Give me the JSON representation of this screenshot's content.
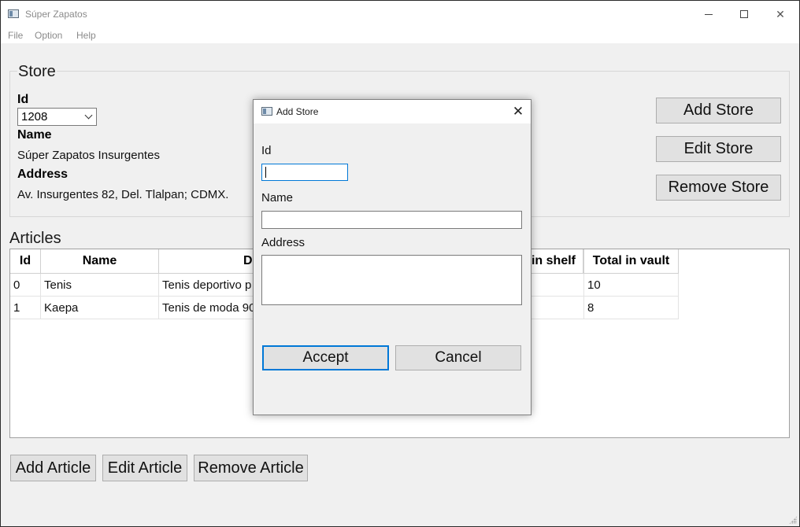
{
  "window": {
    "title": "Súper Zapatos",
    "controls": {
      "minimize": "minimize-icon",
      "maximize": "maximize-icon",
      "close": "✕"
    }
  },
  "menu": [
    "File",
    "Option",
    "Help"
  ],
  "store": {
    "group_title": "Store",
    "id_label": "Id",
    "id_value": "1208",
    "name_label": "Name",
    "name_value": "Súper Zapatos Insurgentes",
    "address_label": "Address",
    "address_value": "Av. Insurgentes 82, Del. Tlalpan; CDMX.",
    "buttons": {
      "add": "Add Store",
      "edit": "Edit Store",
      "remove": "Remove Store"
    }
  },
  "articles": {
    "title": "Articles",
    "columns": [
      "Id",
      "Name",
      "De",
      "in shelf",
      "Total in vault"
    ],
    "rows": [
      {
        "id": "0",
        "name": "Tenis",
        "description": "Tenis deportivo p",
        "total_in_vault": "10"
      },
      {
        "id": "1",
        "name": "Kaepa",
        "description": "Tenis de moda 90",
        "total_in_vault": "8"
      }
    ],
    "buttons": {
      "add": "Add Article",
      "edit": "Edit Article",
      "remove": "Remove Article"
    }
  },
  "dialog": {
    "title": "Add Store",
    "close": "✕",
    "id_label": "Id",
    "id_value": "",
    "name_label": "Name",
    "name_value": "",
    "address_label": "Address",
    "address_value": "",
    "accept": "Accept",
    "cancel": "Cancel"
  },
  "colors": {
    "focus": "#0078d7",
    "window_bg": "#f0f0f0",
    "button_bg": "#e1e1e1"
  }
}
